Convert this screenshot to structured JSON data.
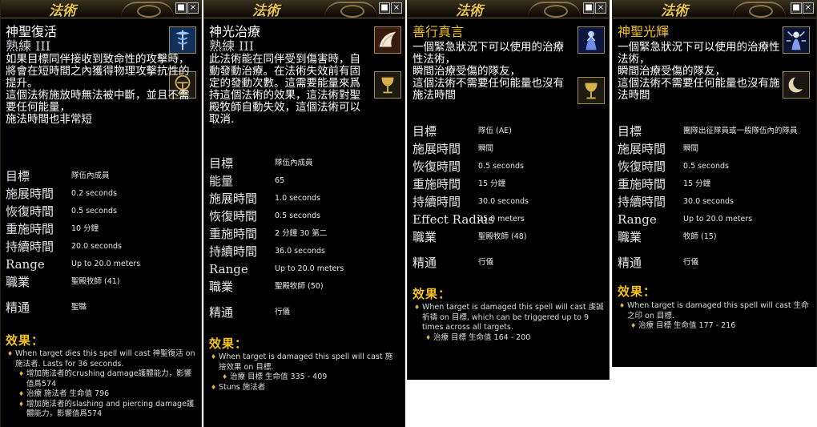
{
  "window_title": "法術",
  "window_controls": {
    "minimize": "■",
    "close": "×"
  },
  "panels": [
    {
      "name": "神聖復活",
      "level": "熟練 III",
      "description": "如果目標同伴接收到致命性的攻擊時，\n將會在短時間之內獲得物理攻擊抗性的提升。\n這個法術施放時無法被中斷，並且不需要任何能量，\n施法時間也非常短",
      "stats": [
        {
          "label": "目標",
          "value": "隊伍內成員"
        },
        {
          "label": "施展時間",
          "value": "0.2 seconds"
        },
        {
          "label": "恢復時間",
          "value": "0.5 seconds"
        },
        {
          "label": "重施時間",
          "value": "10 分鐘"
        },
        {
          "label": "持續時間",
          "value": "20.0 seconds"
        },
        {
          "label": "Range",
          "value": "Up to 20.0 meters"
        },
        {
          "label": "職業",
          "value": "聖殿牧師 (41)"
        },
        {
          "label": "精通",
          "value": "聖職"
        }
      ],
      "effects_heading": "效果：",
      "effects": [
        {
          "text": "When target dies this spell will cast 神聖復活 on 施法者. Lasts for 36 seconds.",
          "sub": false
        },
        {
          "text": "增加施法者的crushing damage護體能力，影響值爲574",
          "sub": true
        },
        {
          "text": "治療 施法者 生命值 796",
          "sub": true
        },
        {
          "text": "增加施法者的slashing and piercing damage護體能力，影響值爲574",
          "sub": true
        }
      ]
    },
    {
      "name": "神光治療",
      "level": "熟練 III",
      "description": "此法術能在同伴受到傷害時，自動發動治療。在法術失效前有固定的發動次數。這需要能量來爲持這個法術的效果，這法術對聖殿牧師自動失效，這個法術可以取消.",
      "stats": [
        {
          "label": "目標",
          "value": "隊伍內成員"
        },
        {
          "label": "能量",
          "value": "65"
        },
        {
          "label": "施展時間",
          "value": "1.0 seconds"
        },
        {
          "label": "恢復時間",
          "value": "0.5 seconds"
        },
        {
          "label": "重施時間",
          "value": "2 分鐘 30 第二"
        },
        {
          "label": "持續時間",
          "value": "36.0 seconds"
        },
        {
          "label": "Range",
          "value": "Up to 20.0 meters"
        },
        {
          "label": "職業",
          "value": "聖殿牧師 (50)"
        },
        {
          "label": "精通",
          "value": "行儀"
        }
      ],
      "effects_heading": "效果：",
      "effects": [
        {
          "text": "When target is damaged this spell will cast 施捨效果 on 目標.",
          "sub": false
        },
        {
          "text": "治療 目標 生命值 335 - 409",
          "sub": true
        },
        {
          "text": "Stuns 施法者",
          "sub": false
        }
      ]
    },
    {
      "name": "善行真言",
      "level": "",
      "description": "一個緊急狀況下可以使用的治療性法術，\n瞬間治療受傷的隊友，\n這個法術不需要任何能量也沒有施法時間",
      "stats": [
        {
          "label": "目標",
          "value": "隊伍 (AE)"
        },
        {
          "label": "施展時間",
          "value": "瞬間"
        },
        {
          "label": "恢復時間",
          "value": "0.5 seconds"
        },
        {
          "label": "重施時間",
          "value": "15 分鐘"
        },
        {
          "label": "持續時間",
          "value": "30.0 seconds"
        },
        {
          "label": "Effect Radius",
          "value": "25.0 meters"
        },
        {
          "label": "職業",
          "value": "聖殿牧師 (48)"
        },
        {
          "label": "精通",
          "value": "行儀"
        }
      ],
      "effects_heading": "效果：",
      "effects": [
        {
          "text": "When target is damaged this spell will cast 虔誠祈禱 on 目標, which can be triggered up to 9 times across all targets.",
          "sub": false
        },
        {
          "text": "治療 目標 生命值 164 - 200",
          "sub": true
        }
      ]
    },
    {
      "name": "神聖光輝",
      "level": "",
      "description": "一個緊急狀況下可以使用的治療性法術，\n瞬間治療受傷的隊友，\n這個法術不需要任何能量也沒有施法時間",
      "stats": [
        {
          "label": "目標",
          "value": "團隊出征隊員或一般隊伍內的隊員"
        },
        {
          "label": "施展時間",
          "value": "瞬間"
        },
        {
          "label": "恢復時間",
          "value": "0.5 seconds"
        },
        {
          "label": "重施時間",
          "value": "15 分鐘"
        },
        {
          "label": "持續時間",
          "value": "30.0 seconds"
        },
        {
          "label": "Range",
          "value": "Up to 20.0 meters"
        },
        {
          "label": "職業",
          "value": "牧師 (15)"
        },
        {
          "label": "精通",
          "value": "行儀"
        }
      ],
      "effects_heading": "效果：",
      "effects": [
        {
          "text": "When target is damaged this spell will cast 生命之印 on 目標.",
          "sub": false
        },
        {
          "text": "治療 目標 生命值 177 - 216",
          "sub": true
        }
      ]
    }
  ],
  "icons": [
    "caduceus-spell-icon",
    "chalice-rune-icon",
    "wing-spell-icon",
    "golden-chalice-icon",
    "praying-figure-icon",
    "golden-chalice-icon",
    "radiant-figure-icon",
    "crescent-moon-icon"
  ],
  "colors": {
    "panel_bg": "#000000",
    "title_gold": "#e8c64a",
    "heading_gold": "#f3c21a",
    "text": "#e8e8e8"
  }
}
